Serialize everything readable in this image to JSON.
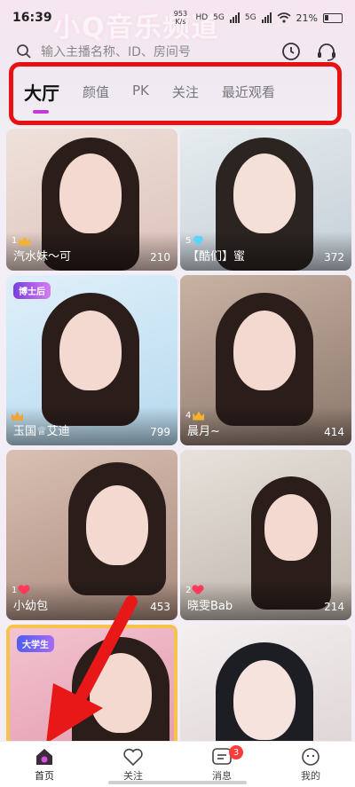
{
  "status_bar": {
    "time": "16:39",
    "net_speed": "953 K/s",
    "network_a": "HD",
    "network_b": "5G",
    "network_c": "5G",
    "battery": "21%"
  },
  "banner_text": "小Q音乐频道",
  "search": {
    "placeholder": "输入主播名称、ID、房间号"
  },
  "tabs": [
    {
      "label": "大厅",
      "active": true
    },
    {
      "label": "颜值",
      "active": false
    },
    {
      "label": "PK",
      "active": false
    },
    {
      "label": "关注",
      "active": false
    },
    {
      "label": "最近观看",
      "active": false
    }
  ],
  "cards": [
    {
      "name": "汽水妹～可",
      "viewers": "210",
      "level": "1",
      "badge": "",
      "level_icon": "crown-icon",
      "bg": "#e6d3cf"
    },
    {
      "name": "【酷们】蜜",
      "viewers": "372",
      "level": "5",
      "badge": "",
      "level_icon": "gem-icon",
      "bg": "#cfd6dc"
    },
    {
      "name": "玉国♕艾迪",
      "viewers": "799",
      "level": "",
      "badge": "博士后",
      "level_icon": "wing-icon",
      "bg": "#c9e4f3"
    },
    {
      "name": "晨月~",
      "viewers": "414",
      "level": "4",
      "badge": "",
      "level_icon": "crown-icon",
      "bg": "#bfa89a"
    },
    {
      "name": "小幼包",
      "viewers": "453",
      "level": "1",
      "badge": "",
      "level_icon": "heart-icon",
      "bg": "#c4a596"
    },
    {
      "name": "晓雯Bab",
      "viewers": "214",
      "level": "2",
      "badge": "",
      "level_icon": "heart-icon",
      "bg": "#d7cfc8"
    },
    {
      "name": "",
      "viewers": "",
      "level": "",
      "badge": "大学生",
      "level_icon": "",
      "bg": "#e9b7c3"
    },
    {
      "name": "",
      "viewers": "",
      "level": "",
      "badge": "",
      "level_icon": "",
      "bg": "#e9e3e3"
    }
  ],
  "bottom_nav": [
    {
      "label": "首页",
      "icon": "home-icon",
      "active": true
    },
    {
      "label": "关注",
      "icon": "heart-outline-icon",
      "active": false
    },
    {
      "label": "消息",
      "icon": "message-icon",
      "active": false,
      "badge": "3"
    },
    {
      "label": "我的",
      "icon": "profile-icon",
      "active": false
    }
  ],
  "colors": {
    "accent": "#c33bd6",
    "highlight_frame": "#e81010",
    "arrow": "#e81818"
  }
}
